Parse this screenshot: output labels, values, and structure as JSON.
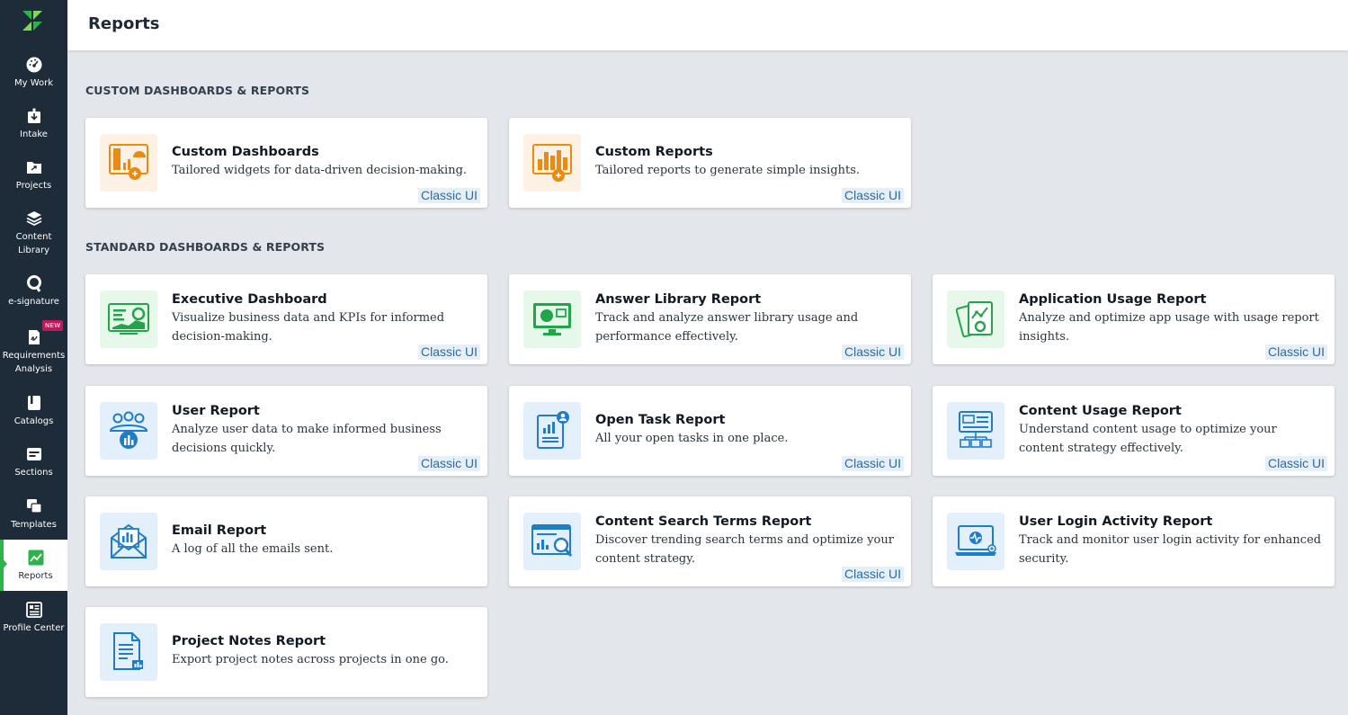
{
  "header": {
    "title": "Reports"
  },
  "nav": [
    {
      "name": "nav-my-work",
      "icon": "dashboard-gauge-icon",
      "label": "My Work"
    },
    {
      "name": "nav-intake",
      "icon": "intake-download-icon",
      "label": "Intake"
    },
    {
      "name": "nav-projects",
      "icon": "projects-folder-icon",
      "label": "Projects"
    },
    {
      "name": "nav-content-library",
      "icon": "layers-stack-icon",
      "label": "Content Library"
    },
    {
      "name": "nav-e-signature",
      "icon": "signature-icon",
      "label": "e-signature"
    },
    {
      "name": "nav-requirements-analysis",
      "icon": "requirements-document-icon",
      "label": "Requirements Analysis"
    },
    {
      "name": "nav-catalogs",
      "icon": "catalog-book-icon",
      "label": "Catalogs"
    },
    {
      "name": "nav-sections",
      "icon": "sections-icon",
      "label": "Sections"
    },
    {
      "name": "nav-templates",
      "icon": "templates-copy-icon",
      "label": "Templates"
    },
    {
      "name": "nav-reports",
      "icon": "reports-chart-icon",
      "label": "Reports"
    },
    {
      "name": "nav-profile-center",
      "icon": "profile-card-icon",
      "label": "Profile Center"
    }
  ],
  "badges": {
    "new": "NEW"
  },
  "sections": {
    "custom": "CUSTOM DASHBOARDS & REPORTS",
    "standard": "STANDARD DASHBOARDS & REPORTS"
  },
  "classic_label": "Classic UI",
  "cards": {
    "custom_dashboards": {
      "title": "Custom Dashboards",
      "desc": "Tailored widgets for data-driven decision-making.",
      "classic": "Classic UI"
    },
    "custom_reports": {
      "title": "Custom Reports",
      "desc": "Tailored reports to generate simple insights.",
      "classic": "Classic UI"
    },
    "executive_dashboard": {
      "title": "Executive Dashboard",
      "desc": "Visualize business data and KPIs for informed decision-making.",
      "classic": "Classic UI"
    },
    "answer_library": {
      "title": "Answer Library Report",
      "desc": "Track and analyze answer library usage and performance effectively.",
      "classic": "Classic UI"
    },
    "application_usage": {
      "title": "Application Usage Report",
      "desc": "Analyze and optimize app usage with usage report insights.",
      "classic": "Classic UI"
    },
    "user_report": {
      "title": "User Report",
      "desc": "Analyze user data to make informed business decisions quickly.",
      "classic": "Classic UI"
    },
    "open_task": {
      "title": "Open Task Report",
      "desc": "All your open tasks in one place.",
      "classic": "Classic UI"
    },
    "content_usage": {
      "title": "Content Usage Report",
      "desc": "Understand content usage to optimize your content strategy effectively.",
      "classic": "Classic UI"
    },
    "email_report": {
      "title": "Email Report",
      "desc": "A log of all the emails sent."
    },
    "content_search_terms": {
      "title": "Content Search Terms Report",
      "desc": "Discover trending search terms and optimize your content strategy.",
      "classic": "Classic UI"
    },
    "user_login_activity": {
      "title": "User Login Activity Report",
      "desc": "Track and monitor user login activity for enhanced security."
    },
    "project_notes": {
      "title": "Project Notes Report",
      "desc": "Export project notes across projects in one go."
    }
  },
  "colors": {
    "sidebar_bg": "#1e2b39",
    "accent_green": "#2eb34a",
    "icon_orange": "#e98a12",
    "icon_green": "#22a548",
    "icon_blue": "#1f7cc9",
    "classic_text": "#2c6aa5"
  }
}
